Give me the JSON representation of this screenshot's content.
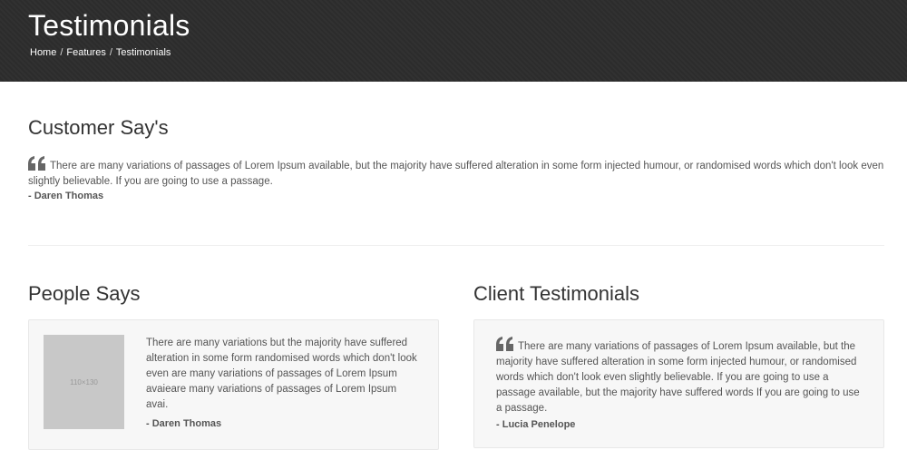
{
  "header": {
    "title": "Testimonials",
    "breadcrumb": [
      "Home",
      "Features",
      "Testimonials"
    ],
    "breadcrumb_separator": "/"
  },
  "customer_section": {
    "heading": "Customer Say's",
    "quote": "There are many variations of passages of Lorem Ipsum available, but the majority have suffered alteration in some form injected humour, or randomised words which don't look even slightly believable. If you are going to use a passage.",
    "author": "- Daren Thomas"
  },
  "people_section": {
    "heading": "People Says",
    "image_label": "110×130",
    "quote": "There are many variations but the majority have suffered alteration in some form randomised words which don't look even are many variations of passages of Lorem Ipsum avaieare many variations of passages of Lorem Ipsum avai.",
    "author": "- Daren Thomas"
  },
  "client_section": {
    "heading": "Client Testimonials",
    "quote": "There are many variations of passages of Lorem Ipsum available, but the majority have suffered alteration in some form injected humour, or randomised words which don't look even slightly believable. If you are going to use a passage available, but the majority have suffered words If you are going to use a passage.",
    "author": "- Lucia Penelope"
  },
  "colors": {
    "hero_bg": "#2c2c2c",
    "text": "#555555",
    "heading": "#333333",
    "card_bg": "#f7f7f7",
    "placeholder": "#c8c8c8"
  },
  "icons": [
    "quote-icon"
  ]
}
